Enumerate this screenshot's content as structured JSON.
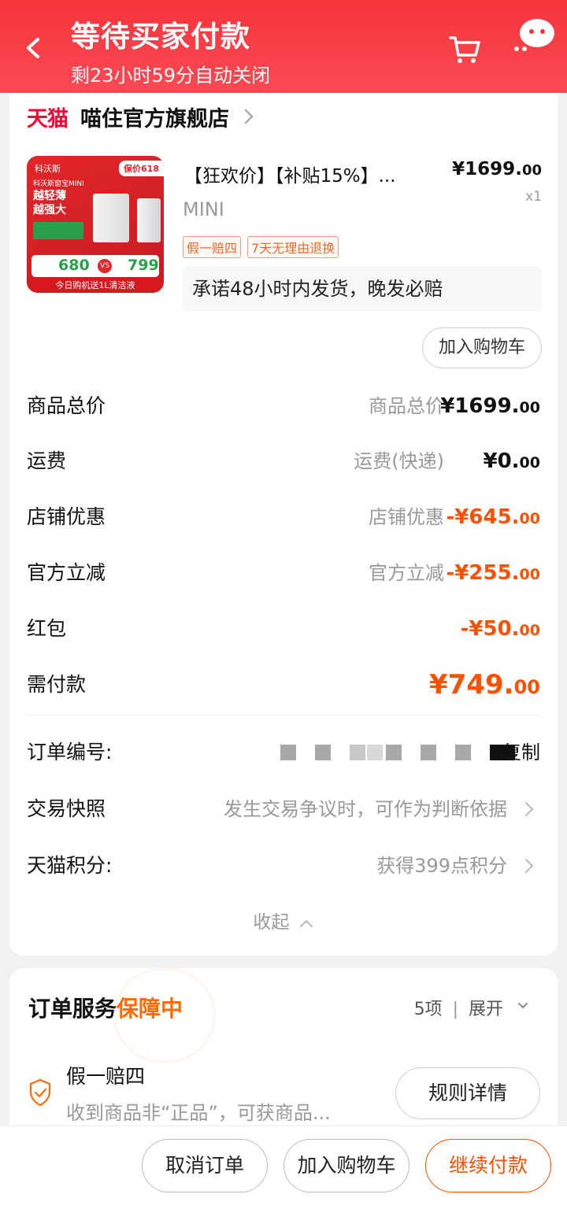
{
  "header": {
    "title": "等待买家付款",
    "subtitle": "剩23小时59分自动关闭",
    "bg_color": "#f5343b"
  },
  "shop": {
    "platform_logo": "天猫",
    "name": "喵住官方旗舰店"
  },
  "product": {
    "title": "【狂欢价】【补贴15%】...",
    "sku": "MINI",
    "price_int": "¥1699.",
    "price_dec": "00",
    "qty": "x1",
    "tags": [
      "假一赔四",
      "7天无理由退换"
    ],
    "promise": "承诺48小时内发货，晚发必赔",
    "add_cart_label": "加入购物车",
    "thumb": {
      "brand": "科沃斯",
      "badge": "保价618",
      "model": "科沃斯窗宝MINI",
      "slogan1": "越轻薄",
      "slogan2": "越强大",
      "price_a": "680",
      "vs": "VS",
      "price_b": "799",
      "gift": "今日购机送1L清洁液"
    }
  },
  "summary": [
    {
      "label": "商品总价",
      "sub": "商品总价",
      "amt_int": "¥1699.",
      "amt_dec": "00",
      "highlight": false
    },
    {
      "label": "运费",
      "sub": "运费(快递)",
      "amt_int": "¥0.",
      "amt_dec": "00",
      "highlight": false
    },
    {
      "label": "店铺优惠",
      "sub": "店铺优惠",
      "amt_int": "-¥645.",
      "amt_dec": "00",
      "highlight": true
    },
    {
      "label": "官方立减",
      "sub": "官方立减",
      "amt_int": "-¥255.",
      "amt_dec": "00",
      "highlight": true
    },
    {
      "label": "红包",
      "sub": "",
      "amt_int": "-¥50.",
      "amt_dec": "00",
      "highlight": true
    },
    {
      "label": "需付款",
      "sub": "",
      "amt_int": "¥749.",
      "amt_dec": "00",
      "highlight": true
    }
  ],
  "order_info": {
    "order_no_label": "订单编号:",
    "copy_label": "复制",
    "snapshot_label": "交易快照",
    "snapshot_value": "发生交易争议时，可作为判断依据",
    "points_label": "天猫积分:",
    "points_value": "获得399点积分",
    "collapse_label": "收起"
  },
  "service": {
    "title": "订单服务",
    "title_highlight": "保障中",
    "count": "5项",
    "separator": "|",
    "expand": "展开",
    "item_title": "假一赔四",
    "item_desc": "收到商品非“正品”，可获商品...",
    "rules_label": "规则详情"
  },
  "footer": {
    "cancel_label": "取消订单",
    "add_cart_label": "加入购物车",
    "pay_label": "继续付款"
  },
  "colors": {
    "accent": "#ff5000",
    "tmall_red": "#ff0036"
  },
  "icons": [
    "back-icon",
    "cart-icon",
    "chat-icon",
    "chevron-right-icon",
    "chevron-up-icon",
    "chevron-down-icon",
    "shield-check-icon"
  ]
}
